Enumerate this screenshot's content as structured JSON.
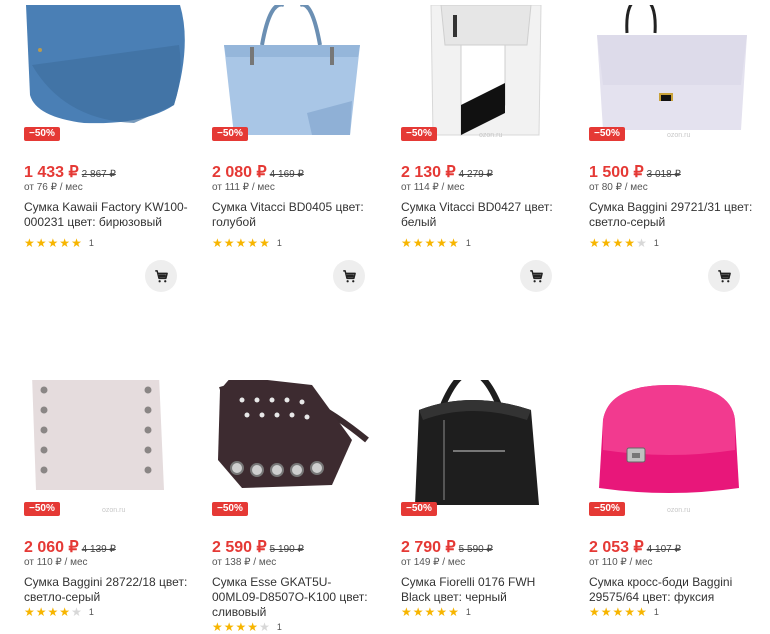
{
  "products": [
    {
      "discount": "−50%",
      "price": "1 433 ₽",
      "old_price": "2 867 ₽",
      "installment": "от 76 ₽ / мес",
      "title": "Сумка Kawaii Factory KW100-000231 цвет: бирюзовый",
      "rating": 5,
      "reviews": "1",
      "image": "blue-saddle-bag"
    },
    {
      "discount": "−50%",
      "price": "2 080 ₽",
      "old_price": "4 169 ₽",
      "installment": "от 111 ₽ / мес",
      "title": "Сумка Vitacci BD0405 цвет: голубой",
      "rating": 5,
      "reviews": "1",
      "image": "light-blue-tote-bag"
    },
    {
      "discount": "−50%",
      "price": "2 130 ₽",
      "old_price": "4 279 ₽",
      "installment": "от 114 ₽ / мес",
      "title": "Сумка Vitacci BD0427 цвет: белый",
      "rating": 5,
      "reviews": "1",
      "image": "white-black-bag"
    },
    {
      "discount": "−50%",
      "price": "1 500 ₽",
      "old_price": "3 018 ₽",
      "installment": "от 80 ₽ / мес",
      "title": "Сумка Baggini 29721/31 цвет: светло-серый",
      "rating": 4,
      "reviews": "1",
      "image": "lavender-top-handle-bag"
    },
    {
      "discount": "−50%",
      "price": "2 060 ₽",
      "old_price": "4 139 ₽",
      "installment": "от 110 ₽ / мес",
      "title": "Сумка Baggini 28722/18 цвет: светло-серый",
      "rating": 4,
      "reviews": "1",
      "image": "grey-studded-tote"
    },
    {
      "discount": "−50%",
      "price": "2 590 ₽",
      "old_price": "5 190 ₽",
      "installment": "от 138 ₽ / мес",
      "title": "Сумка Esse GKAT5U-00ML09-D8507O-K100 цвет: сливовый",
      "rating": 4,
      "reviews": "1",
      "image": "plum-grommet-bag"
    },
    {
      "discount": "−50%",
      "price": "2 790 ₽",
      "old_price": "5 590 ₽",
      "installment": "от 149 ₽ / мес",
      "title": "Сумка Fiorelli 0176 FWH Black цвет: черный",
      "rating": 5,
      "reviews": "1",
      "image": "black-hobo-bag"
    },
    {
      "discount": "−50%",
      "price": "2 053 ₽",
      "old_price": "4 107 ₽",
      "installment": "от 110 ₽ / мес",
      "title": "Сумка кросс-боди Baggini 29575/64 цвет: фуксия",
      "rating": 5,
      "reviews": "1",
      "image": "fuchsia-crossbody-bag"
    }
  ],
  "watermark": "ozon.ru",
  "colors": {
    "accent": "#e53935",
    "star": "#f7b500"
  },
  "icons": {
    "cart": "cart-icon",
    "star": "star-icon"
  }
}
